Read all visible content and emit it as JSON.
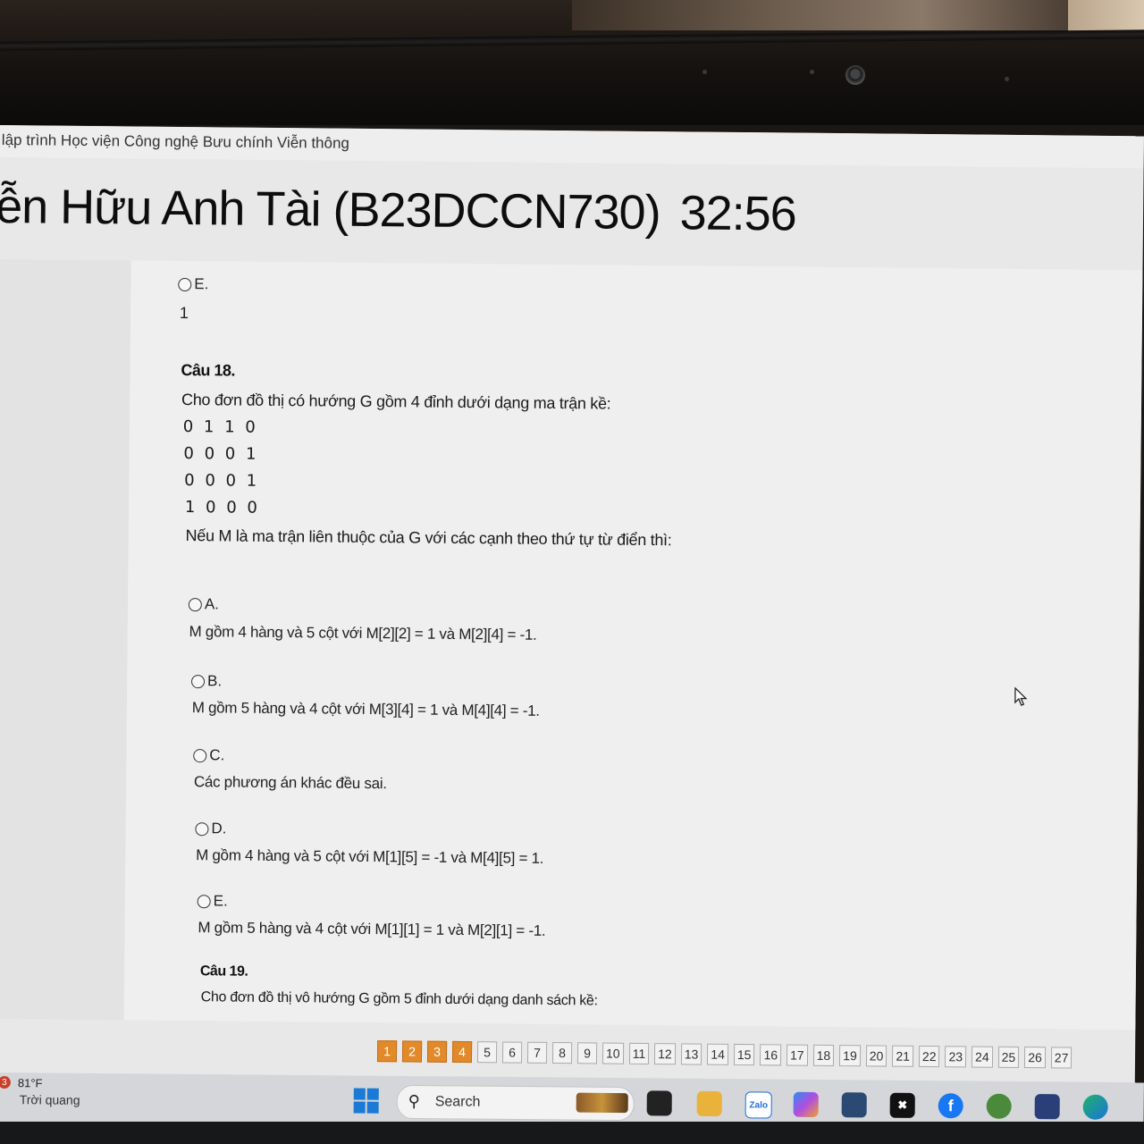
{
  "browser": {
    "site_title": "lập trình Học viện Công nghệ Bưu chính Viễn thông"
  },
  "header": {
    "student_name": "ễn Hữu Anh Tài (B23DCCN730)",
    "timer": "32:56"
  },
  "prev_question": {
    "option_label": "E.",
    "option_text": "1"
  },
  "question18": {
    "title": "Câu 18.",
    "intro": "Cho đơn đồ thị có hướng G gồm 4 đỉnh dưới dạng ma trận kề:",
    "matrix": [
      "0 1 1 0",
      "0 0 0 1",
      "0 0 0 1",
      "1 0 0 0"
    ],
    "prompt": "Nếu M là ma trận liên thuộc của G với các cạnh theo thứ tự từ điển thì:",
    "options": [
      {
        "label": "A.",
        "text": "M gồm 4 hàng và 5 cột với M[2][2] = 1 và M[2][4] = -1."
      },
      {
        "label": "B.",
        "text": "M gồm 5 hàng và 4 cột với M[3][4] = 1 và M[4][4] = -1."
      },
      {
        "label": "C.",
        "text": "Các phương án khác đều sai."
      },
      {
        "label": "D.",
        "text": "M gồm 4 hàng và 5 cột với M[1][5] = -1 và M[4][5] = 1."
      },
      {
        "label": "E.",
        "text": "M gồm 5 hàng và 4 cột với M[1][1] = 1 và M[2][1] = -1."
      }
    ]
  },
  "question19": {
    "title": "Câu 19.",
    "intro": "Cho đơn đồ thị vô hướng G gồm 5 đỉnh dưới dạng danh sách kề:"
  },
  "pager": {
    "pages": [
      "1",
      "2",
      "3",
      "4",
      "5",
      "6",
      "7",
      "8",
      "9",
      "10",
      "11",
      "12",
      "13",
      "14",
      "15",
      "16",
      "17",
      "18",
      "19",
      "20",
      "21",
      "22",
      "23",
      "24",
      "25",
      "26",
      "27"
    ],
    "answered": [
      "1",
      "2",
      "3",
      "4"
    ]
  },
  "taskbar": {
    "weather_badge": "3",
    "weather_temp": "81°F",
    "weather_desc": "Trời quang",
    "search_label": "Search",
    "icons": [
      "file-explorer-icon",
      "folder-icon",
      "zalo-icon",
      "copilot-icon",
      "store-icon",
      "xbox-icon",
      "facebook-icon",
      "app-icon",
      "terminal-icon",
      "edge-icon"
    ]
  },
  "colors": {
    "answered_page": "#e28a2a",
    "screen_bg": "#efefef",
    "windows_blue": "#1a7ad6"
  }
}
